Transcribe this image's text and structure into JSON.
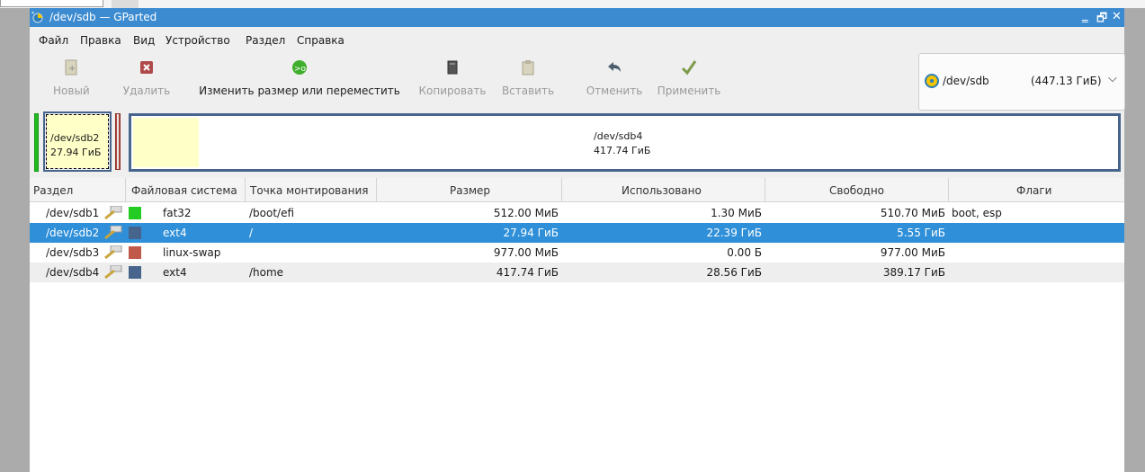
{
  "window": {
    "title": "/dev/sdb — GParted"
  },
  "menu": [
    "Файл",
    "Правка",
    "Вид",
    "Устройство",
    "Раздел",
    "Справка"
  ],
  "toolbar": {
    "new": "Новый",
    "delete": "Удалить",
    "resize": "Изменить размер или переместить",
    "copy": "Копировать",
    "paste": "Вставить",
    "undo": "Отменить",
    "apply": "Применить"
  },
  "device": {
    "name": "/dev/sdb",
    "size": "(447.13 ГиБ)"
  },
  "diskmap": {
    "sdb2": {
      "name": "/dev/sdb2",
      "size": "27.94 ГиБ"
    },
    "sdb4": {
      "name": "/dev/sdb4",
      "size": "417.74 ГиБ"
    }
  },
  "columns": [
    "Раздел",
    "Файловая система",
    "Точка монтирования",
    "Размер",
    "Использовано",
    "Свободно",
    "Флаги"
  ],
  "rows": [
    {
      "partition": "/dev/sdb1",
      "fs": "fat32",
      "mount": "/boot/efi",
      "size": "512.00 МиБ",
      "used": "1.30 МиБ",
      "free": "510.70 МиБ",
      "flags": "boot, esp",
      "color": "#22cc22"
    },
    {
      "partition": "/dev/sdb2",
      "fs": "ext4",
      "mount": "/",
      "size": "27.94 ГиБ",
      "used": "22.39 ГиБ",
      "free": "5.55 ГиБ",
      "flags": "",
      "color": "#47658c"
    },
    {
      "partition": "/dev/sdb3",
      "fs": "linux-swap",
      "mount": "",
      "size": "977.00 МиБ",
      "used": "0.00 Б",
      "free": "977.00 МиБ",
      "flags": "",
      "color": "#c0594a"
    },
    {
      "partition": "/dev/sdb4",
      "fs": "ext4",
      "mount": "/home",
      "size": "417.74 ГиБ",
      "used": "28.56 ГиБ",
      "free": "389.17 ГиБ",
      "flags": "",
      "color": "#47658c"
    }
  ]
}
